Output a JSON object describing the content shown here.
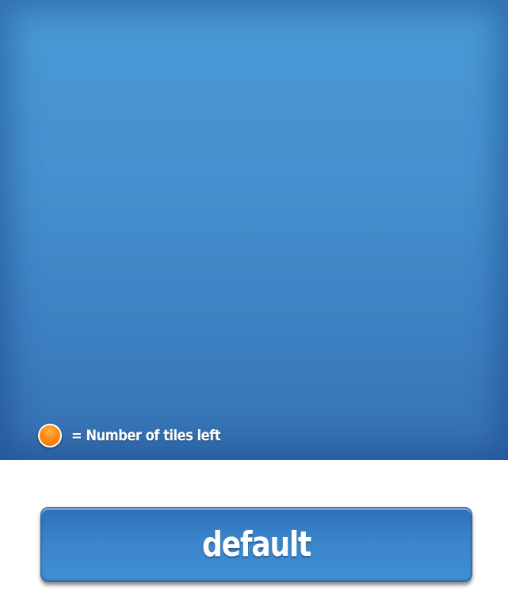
{
  "board": {
    "background_color": "#4590ce"
  },
  "legend": {
    "icon": "orange-dot-icon",
    "icon_color": "#ff8c12",
    "text": "= Number of tiles left"
  },
  "button": {
    "label": "default",
    "color": "#3a84cb"
  }
}
